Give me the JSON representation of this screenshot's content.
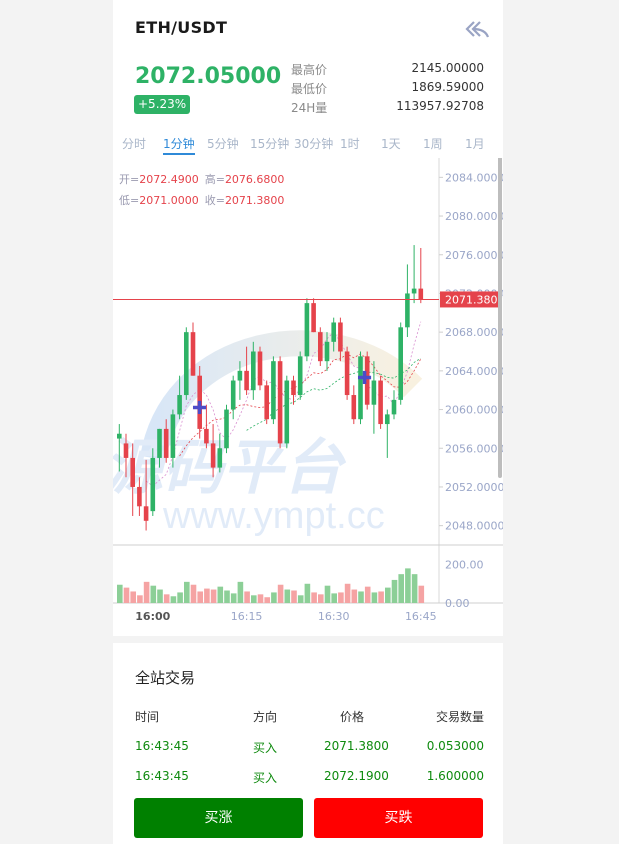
{
  "header": {
    "pair": "ETH/USDT"
  },
  "ticker": {
    "last_price": "2072.05000",
    "change": "+5.23%",
    "high_label": "最高价",
    "high": "2145.00000",
    "low_label": "最低价",
    "low": "1869.59000",
    "vol_label": "24H量",
    "vol": "113957.92708"
  },
  "tabs": [
    "分时",
    "1分钟",
    "5分钟",
    "15分钟",
    "30分钟",
    "1时",
    "1天",
    "1周",
    "1月"
  ],
  "active_tab": "1分钟",
  "ohlc": {
    "open_label": "开=",
    "open": "2072.4900",
    "high_label": "高=",
    "high": "2076.6800",
    "low_label": "低=",
    "low": "2071.0000",
    "close_label": "收=",
    "close": "2071.3800"
  },
  "watermark": {
    "cn": "源码平台",
    "url": "www.ympt.cc"
  },
  "colors": {
    "up": "#2eb266",
    "down": "#e5434b",
    "accent": "#2f8ad8",
    "buy_btn": "#008000",
    "sell_btn": "#ff0000"
  },
  "chart_data": {
    "type": "candlestick",
    "y_ticks": [
      "2084.0000",
      "2080.0000",
      "2076.0000",
      "2072.0000",
      "2068.0000",
      "2064.0000",
      "2060.0000",
      "2056.0000",
      "2052.0000",
      "2048.0000"
    ],
    "ylim": [
      2046,
      2086
    ],
    "x_ticks": [
      "16:00",
      "16:15",
      "16:30",
      "16:45"
    ],
    "current_price_label": "2071.3800",
    "current_price": 2071.38,
    "volume_ticks": [
      "200.00",
      "0.00"
    ],
    "volume_ylim": [
      0,
      260
    ],
    "candles": [
      [
        2057.0,
        2058.5,
        2053.6,
        2057.5
      ],
      [
        2056.5,
        2057.5,
        2053.0,
        2055.0
      ],
      [
        2055.0,
        2056.5,
        2049.0,
        2052.0
      ],
      [
        2052.0,
        2053.0,
        2049.0,
        2050.0
      ],
      [
        2050.0,
        2054.8,
        2047.5,
        2048.5
      ],
      [
        2049.5,
        2056.0,
        2049.0,
        2055.0
      ],
      [
        2055.0,
        2058.0,
        2054.0,
        2058.0
      ],
      [
        2058.0,
        2059.0,
        2054.5,
        2055.0
      ],
      [
        2055.0,
        2060.0,
        2054.0,
        2059.5
      ],
      [
        2059.5,
        2063.5,
        2059.0,
        2061.5
      ],
      [
        2061.5,
        2068.5,
        2061.0,
        2068.0
      ],
      [
        2068.0,
        2069.0,
        2063.5,
        2063.5
      ],
      [
        2063.5,
        2064.5,
        2057.0,
        2058.0
      ],
      [
        2058.0,
        2060.5,
        2056.0,
        2056.5
      ],
      [
        2056.5,
        2058.5,
        2053.0,
        2054.0
      ],
      [
        2054.0,
        2057.5,
        2053.5,
        2056.0
      ],
      [
        2056.0,
        2060.5,
        2055.5,
        2060.0
      ],
      [
        2060.0,
        2063.5,
        2059.0,
        2063.0
      ],
      [
        2063.0,
        2065.0,
        2061.0,
        2064.0
      ],
      [
        2064.0,
        2066.5,
        2061.5,
        2062.0
      ],
      [
        2062.0,
        2067.0,
        2061.0,
        2066.0
      ],
      [
        2066.0,
        2066.5,
        2062.0,
        2062.5
      ],
      [
        2062.5,
        2063.0,
        2058.5,
        2059.0
      ],
      [
        2059.0,
        2065.5,
        2058.5,
        2065.0
      ],
      [
        2065.0,
        2065.5,
        2056.0,
        2056.5
      ],
      [
        2056.5,
        2063.5,
        2056.0,
        2063.0
      ],
      [
        2063.0,
        2063.5,
        2060.5,
        2061.5
      ],
      [
        2061.5,
        2066.0,
        2061.0,
        2065.5
      ],
      [
        2065.5,
        2071.5,
        2065.0,
        2071.0
      ],
      [
        2071.0,
        2071.5,
        2068.0,
        2068.0
      ],
      [
        2068.0,
        2068.5,
        2064.5,
        2065.0
      ],
      [
        2065.0,
        2068.0,
        2064.0,
        2067.0
      ],
      [
        2067.0,
        2069.5,
        2066.0,
        2069.0
      ],
      [
        2069.0,
        2069.5,
        2065.0,
        2066.0
      ],
      [
        2066.0,
        2066.5,
        2061.0,
        2061.5
      ],
      [
        2061.5,
        2062.5,
        2058.5,
        2059.0
      ],
      [
        2059.0,
        2066.0,
        2058.5,
        2065.5
      ],
      [
        2065.5,
        2066.0,
        2060.0,
        2060.5
      ],
      [
        2060.5,
        2065.0,
        2057.5,
        2063.0
      ],
      [
        2063.0,
        2063.5,
        2058.0,
        2058.5
      ],
      [
        2058.5,
        2060.0,
        2055.0,
        2059.5
      ],
      [
        2059.5,
        2062.0,
        2059.0,
        2061.0
      ],
      [
        2061.0,
        2069.0,
        2060.5,
        2068.5
      ],
      [
        2068.5,
        2075.0,
        2067.5,
        2072.0
      ],
      [
        2072.0,
        2077.0,
        2071.0,
        2072.5
      ],
      [
        2072.5,
        2076.7,
        2071.0,
        2071.4
      ]
    ],
    "volumes": [
      95,
      80,
      60,
      40,
      110,
      90,
      70,
      45,
      35,
      55,
      110,
      95,
      60,
      75,
      70,
      85,
      65,
      50,
      110,
      60,
      40,
      45,
      30,
      55,
      95,
      70,
      65,
      40,
      100,
      55,
      45,
      90,
      50,
      55,
      100,
      70,
      60,
      85,
      55,
      60,
      80,
      120,
      150,
      180,
      150,
      90
    ]
  },
  "trades": {
    "title": "全站交易",
    "headers": [
      "时间",
      "方向",
      "价格",
      "交易数量"
    ],
    "rows": [
      [
        "16:43:45",
        "买入",
        "2071.3800",
        "0.053000"
      ],
      [
        "16:43:45",
        "买入",
        "2072.1900",
        "1.600000"
      ]
    ]
  },
  "buttons": {
    "buy": "买涨",
    "sell": "买跌"
  }
}
